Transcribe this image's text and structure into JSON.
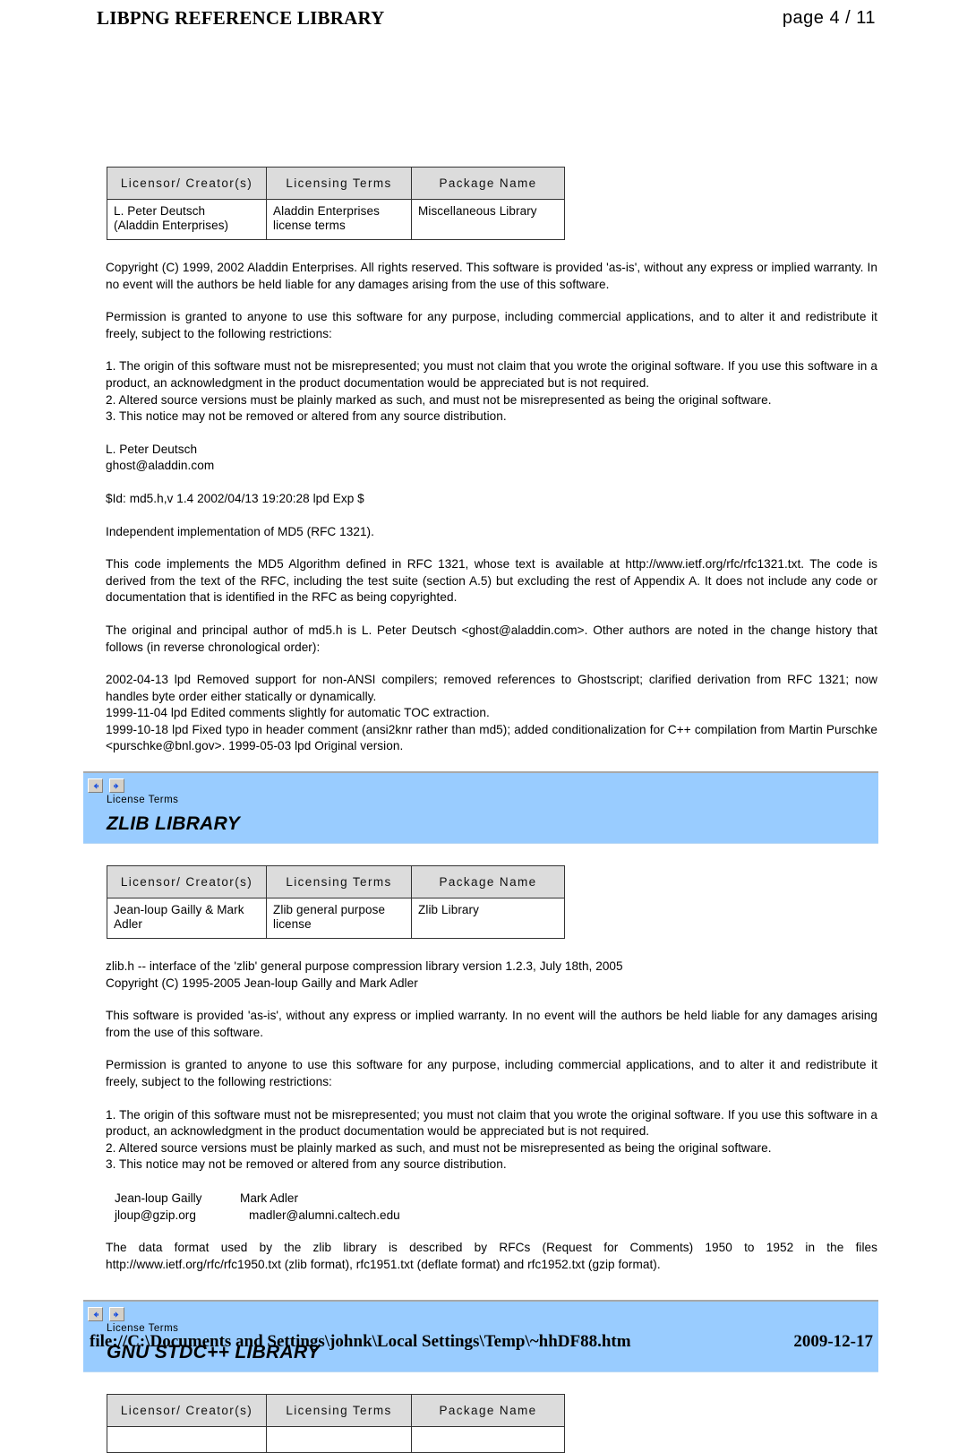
{
  "header": {
    "title": "LIBPNG REFERENCE LIBRARY",
    "page_label": "page  4 / 11"
  },
  "table_headers": {
    "licensor": "Licensor/ Creator(s)",
    "licensing_terms": "Licensing Terms",
    "package_name": "Package Name"
  },
  "sections": [
    {
      "id": "aladdin",
      "table_row": {
        "licensor": "L. Peter Deutsch\n(Aladdin Enterprises)",
        "licensing_terms": "Aladdin Enterprises\nlicense terms",
        "package_name": "Miscellaneous Library"
      },
      "paragraphs": {
        "copyright": "Copyright (C) 1999, 2002 Aladdin Enterprises.  All rights reserved.  This software is provided 'as-is', without any express or implied warranty.  In no event will the authors be held liable for any damages arising from the use of this software.",
        "permission": "Permission is granted to anyone to use this software for any purpose, including commercial applications, and to alter it and redistribute it freely, subject to the following restrictions:",
        "restriction_1": "1. The origin of this software must not be misrepresented; you must not claim that you wrote the original software. If you use this software in a product, an acknowledgment in the product documentation would be appreciated but is not required.",
        "restriction_2": "2. Altered source versions must be plainly marked as such, and must not be misrepresented as being the original software.",
        "restriction_3": "3. This notice may not be removed or altered from any source distribution.",
        "author_name": "L. Peter Deutsch",
        "author_email": "ghost@aladdin.com",
        "rcs_id": "$Id: md5.h,v 1.4 2002/04/13 19:20:28 lpd Exp $",
        "independent_impl": "Independent implementation of MD5 (RFC 1321).",
        "code_implements": "This code implements the MD5 Algorithm defined in RFC 1321, whose text is available at http://www.ietf.org/rfc/rfc1321.txt. The code is derived from the text of the RFC, including the test suite (section A.5) but excluding the rest of Appendix A.  It does not include any code or documentation that is identified in the RFC as being copyrighted.",
        "original_author": "The original and principal author of md5.h is L. Peter Deutsch <ghost@aladdin.com>.  Other authors are noted in the change history that follows (in reverse chronological order):",
        "change_2002": "2002-04-13 lpd Removed support for non-ANSI compilers; removed references to Ghostscript; clarified derivation from RFC 1321; now handles byte order either statically or dynamically.",
        "change_1999_11": "1999-11-04 lpd Edited comments slightly for automatic TOC extraction.",
        "change_1999_10": "1999-10-18 lpd Fixed typo in header comment (ansi2knr rather than md5); added conditionalization for C++ compilation from Martin Purschke <purschke@bnl.gov>.  1999-05-03 lpd Original version."
      }
    },
    {
      "id": "zlib",
      "banner": {
        "caption": "License Terms",
        "title": "ZLIB LIBRARY",
        "back_icon": "arrow-left-icon",
        "forward_icon": "arrow-right-icon"
      },
      "table_row": {
        "licensor": "Jean-loup Gailly & Mark\nAdler",
        "licensing_terms": "Zlib general purpose\nlicense",
        "package_name": "Zlib Library"
      },
      "paragraphs": {
        "interface_line": "zlib.h -- interface of the 'zlib' general purpose compression library version 1.2.3, July 18th, 2005",
        "copyright_line": "Copyright (C) 1995-2005 Jean-loup Gailly and Mark Adler",
        "as_is": "This software is provided 'as-is', without any express or implied warranty.  In no event will the authors be held liable for any damages arising from the use of this software.",
        "permission": "Permission is granted to anyone to use this software for any purpose, including commercial applications, and to alter it and redistribute it freely, subject to the following restrictions:",
        "restriction_1": "1. The origin of this software must not be misrepresented; you must not claim that you wrote the original software. If you use this software in a product, an acknowledgment in the product documentation would be appreciated but is not required.",
        "restriction_2": "2. Altered source versions must be plainly marked as such, and must not be misrepresented as being the original software.",
        "restriction_3": "3. This notice may not be removed or altered from any source distribution.",
        "contact_name_1": "Jean-loup Gailly",
        "contact_name_2": "Mark Adler",
        "contact_email_1": "jloup@gzip.org",
        "contact_email_2": "madler@alumni.caltech.edu",
        "rfc_note": "The data format used by the zlib library is described by RFCs (Request for Comments) 1950 to 1952 in the files http://www.ietf.org/rfc/rfc1950.txt (zlib format), rfc1951.txt (deflate format) and rfc1952.txt (gzip format)."
      }
    },
    {
      "id": "gnu-stdcpp",
      "banner": {
        "caption": "License Terms",
        "title": "GNU STDC++ LIBRARY",
        "back_icon": "arrow-left-icon",
        "forward_icon": "arrow-right-icon"
      },
      "table_row": {
        "licensor": "",
        "licensing_terms": "",
        "package_name": ""
      }
    }
  ],
  "footer": {
    "path": "file://C:\\Documents and Settings\\johnk\\Local Settings\\Temp\\~hhDF88.htm",
    "date": "2009-12-17"
  },
  "colors": {
    "banner_blue": "#99ccff",
    "table_header_gray": "#dcdcdc",
    "nav_arrow_blue": "#2255dd"
  }
}
